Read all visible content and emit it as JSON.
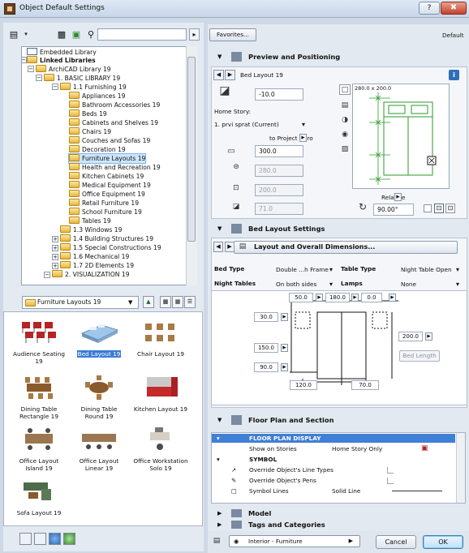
{
  "window": {
    "title": "Object Default Settings",
    "help": "?",
    "close": "✖"
  },
  "tree": {
    "items": [
      "Embedded Library",
      "Linked Libraries",
      "ArchiCAD Library 19",
      "1. BASIC LIBRARY 19",
      "1.1 Furnishing 19",
      "Appliances 19",
      "Bathroom Accessories 19",
      "Beds 19",
      "Cabinets and Shelves 19",
      "Chairs 19",
      "Couches and Sofas 19",
      "Decoration 19",
      "Furniture Layouts 19",
      "Health and Recreation 19",
      "Kitchen Cabinets 19",
      "Medical Equipment 19",
      "Office Equipment 19",
      "Retail Furniture 19",
      "School Furniture 19",
      "Tables 19",
      "1.3 Windows 19",
      "1.4 Building Structures 19",
      "1.5 Special Constructions 19",
      "1.6 Mechanical 19",
      "1.7 2D Elements 19",
      "2. VISUALIZATION 19"
    ]
  },
  "folder_select": "Furniture Layouts 19",
  "objects": [
    "Audience Seating 19",
    "Bed Layout 19",
    "Chair Layout 19",
    "Dining Table Rectangle 19",
    "Dining Table Round 19",
    "Kitchen Layout 19",
    "Office Layout Island 19",
    "Office Layout Linear 19",
    "Office Workstation Solo 19",
    "Sofa Layout 19"
  ],
  "favorites": "Favorites...",
  "default_label": "Default",
  "preview": {
    "header": "Preview and Positioning",
    "object_name": "Bed Layout 19",
    "elevation": "-10.0",
    "home_story_label": "Home Story:",
    "home_story": "1. prvi sprat (Current)",
    "to_project_zero": "to Project Zero",
    "project_zero_value": "300.0",
    "width": "280.0",
    "depth": "200.0",
    "height": "71.0",
    "size_readout": "280.0 x 200.0",
    "relative_label": "Relative",
    "angle": "90.00°"
  },
  "bed_settings": {
    "header": "Bed Layout Settings",
    "subpage": "Layout and Overall Dimensions...",
    "bed_type_label": "Bed Type",
    "bed_type_value": "Double ...h Frame",
    "table_type_label": "Table Type",
    "table_type_value": "Night Table Open",
    "night_tables_label": "Night Tables",
    "night_tables_value": "On both sides",
    "lamps_label": "Lamps",
    "lamps_value": "None",
    "dims": {
      "top_left": "50.0",
      "top_mid": "180.0",
      "top_right": "0.0",
      "left_top": "30.0",
      "left_mid": "150.0",
      "left_bottom": "90.0",
      "right": "200.0",
      "bottom_left": "120.0",
      "bottom_right": "70.0"
    },
    "bed_length": "Bed Length"
  },
  "floor_plan": {
    "header": "Floor Plan and Section",
    "rows": [
      {
        "label": "FLOOR PLAN DISPLAY",
        "value": ""
      },
      {
        "label": "Show on Stories",
        "value": "Home Story Only"
      },
      {
        "label": "SYMBOL",
        "value": ""
      },
      {
        "label": "Override Object's Line Types",
        "value": ""
      },
      {
        "label": "Override Object's Pens",
        "value": ""
      },
      {
        "label": "Symbol Lines",
        "value": "Solid Line"
      }
    ]
  },
  "model_header": "Model",
  "tags_header": "Tags and Categories",
  "layer": "Interior - Furniture",
  "buttons": {
    "cancel": "Cancel",
    "ok": "OK"
  }
}
